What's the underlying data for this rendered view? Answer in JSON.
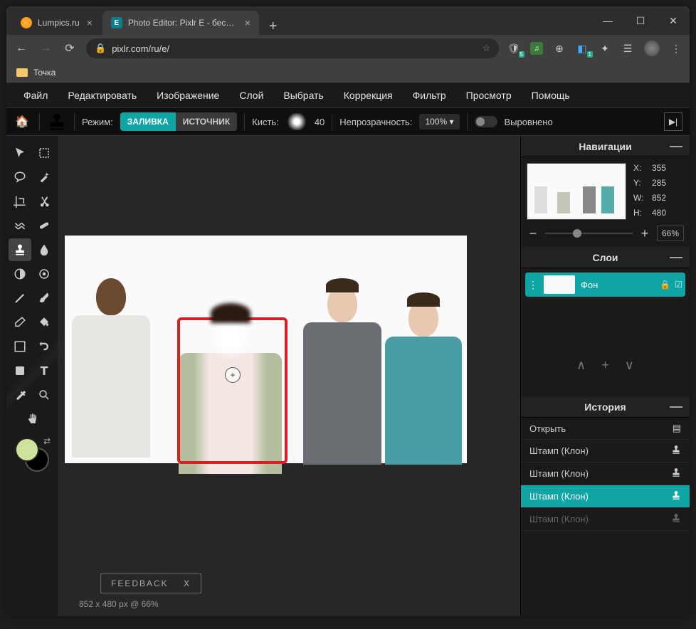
{
  "browser": {
    "tabs": [
      {
        "label": "Lumpics.ru",
        "active": false
      },
      {
        "label": "Photo Editor: Pixlr E - бесплатны",
        "active": true
      }
    ],
    "url": "pixlr.com/ru/e/",
    "bookmark": "Точка"
  },
  "menu": [
    "Файл",
    "Редактировать",
    "Изображение",
    "Слой",
    "Выбрать",
    "Коррекция",
    "Фильтр",
    "Просмотр",
    "Помощь"
  ],
  "toolbar": {
    "mode_label": "Режим:",
    "mode_fill": "ЗАЛИВКА",
    "mode_source": "ИСТОЧНИК",
    "brush_label": "Кисть:",
    "brush_size": "40",
    "opacity_label": "Непрозрачность:",
    "opacity_value": "100% ▾",
    "aligned_label": "Выровнено"
  },
  "nav": {
    "title": "Навигации",
    "x_label": "X:",
    "x_val": "355",
    "y_label": "Y:",
    "y_val": "285",
    "w_label": "W:",
    "w_val": "852",
    "h_label": "H:",
    "h_val": "480",
    "zoom": "66%"
  },
  "layers": {
    "title": "Слои",
    "layer_name": "Фон"
  },
  "history": {
    "title": "История",
    "items": [
      {
        "label": "Открыть",
        "icon": "open",
        "active": false,
        "dim": false
      },
      {
        "label": "Штамп (Клон)",
        "icon": "stamp",
        "active": false,
        "dim": false
      },
      {
        "label": "Штамп (Клон)",
        "icon": "stamp",
        "active": false,
        "dim": false
      },
      {
        "label": "Штамп (Клон)",
        "icon": "stamp",
        "active": true,
        "dim": false
      },
      {
        "label": "Штамп (Клон)",
        "icon": "stamp",
        "active": false,
        "dim": true
      }
    ]
  },
  "feedback": {
    "label": "FEEDBACK",
    "close": "X"
  },
  "status": "852 x 480 px @ 66%"
}
